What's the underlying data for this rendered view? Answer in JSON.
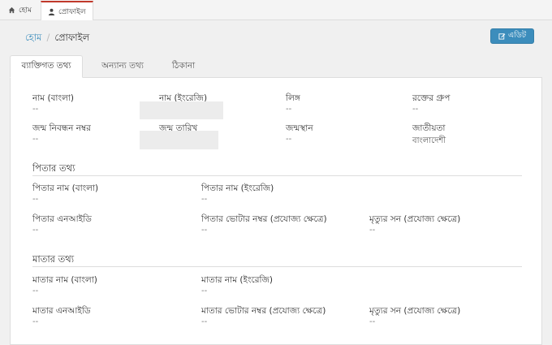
{
  "top_tabs": {
    "home": "হোম",
    "profile": "প্রোফাইল"
  },
  "breadcrumb": {
    "home": "হোম",
    "separator": "/",
    "current": "প্রোফাইল"
  },
  "edit_button": "এডিট",
  "tabs": [
    "ব্যাক্তিগত তথ্য",
    "অন্যান্য তথ্য",
    "ঠিকানা"
  ],
  "personal": {
    "name_bn": {
      "label": "নাম (বাংলা)",
      "value": "--"
    },
    "name_en": {
      "label": "নাম (ইংরেজি)"
    },
    "gender": {
      "label": "লিঙ্গ",
      "value": "--"
    },
    "blood_group": {
      "label": "রক্তের গ্রুপ",
      "value": "--"
    },
    "birth_reg": {
      "label": "জন্ম নিবন্ধন নম্বর",
      "value": "--"
    },
    "dob": {
      "label": "জন্ম তারিখ"
    },
    "birth_place": {
      "label": "জন্মস্থান",
      "value": "--"
    },
    "nationality": {
      "label": "জাতীয়তা",
      "value": "বাংলাদেশী"
    }
  },
  "father": {
    "title": "পিতার তথ্য",
    "name_bn": {
      "label": "পিতার নাম (বাংলা)",
      "value": "--"
    },
    "name_en": {
      "label": "পিতার নাম (ইংরেজি)",
      "value": "--"
    },
    "nid": {
      "label": "পিতার এনআইডি",
      "value": "--"
    },
    "voter_no": {
      "label": "পিতার ভোটার নম্বর (প্রযোজ্য ক্ষেত্রে)",
      "value": "--"
    },
    "death_year": {
      "label": "মৃত্যুর সন (প্রযোজ্য ক্ষেত্রে)",
      "value": "--"
    }
  },
  "mother": {
    "title": "মাতার তথ্য",
    "name_bn": {
      "label": "মাতার নাম (বাংলা)",
      "value": "--"
    },
    "name_en": {
      "label": "মাতার নাম (ইংরেজি)",
      "value": "--"
    },
    "nid": {
      "label": "মাতার এনআইডি",
      "value": "--"
    },
    "voter_no": {
      "label": "মাতার ভোটার নম্বর (প্রযোজ্য ক্ষেত্রে)",
      "value": "--"
    },
    "death_year": {
      "label": "মৃত্যুর সন (প্রযোজ্য ক্ষেত্রে)",
      "value": "--"
    }
  },
  "colors": {
    "accent": "#3c8dbc",
    "active_tab_border": "#c0392b"
  },
  "icons": {
    "home": "home-icon",
    "user": "user-icon",
    "edit": "edit-icon"
  }
}
